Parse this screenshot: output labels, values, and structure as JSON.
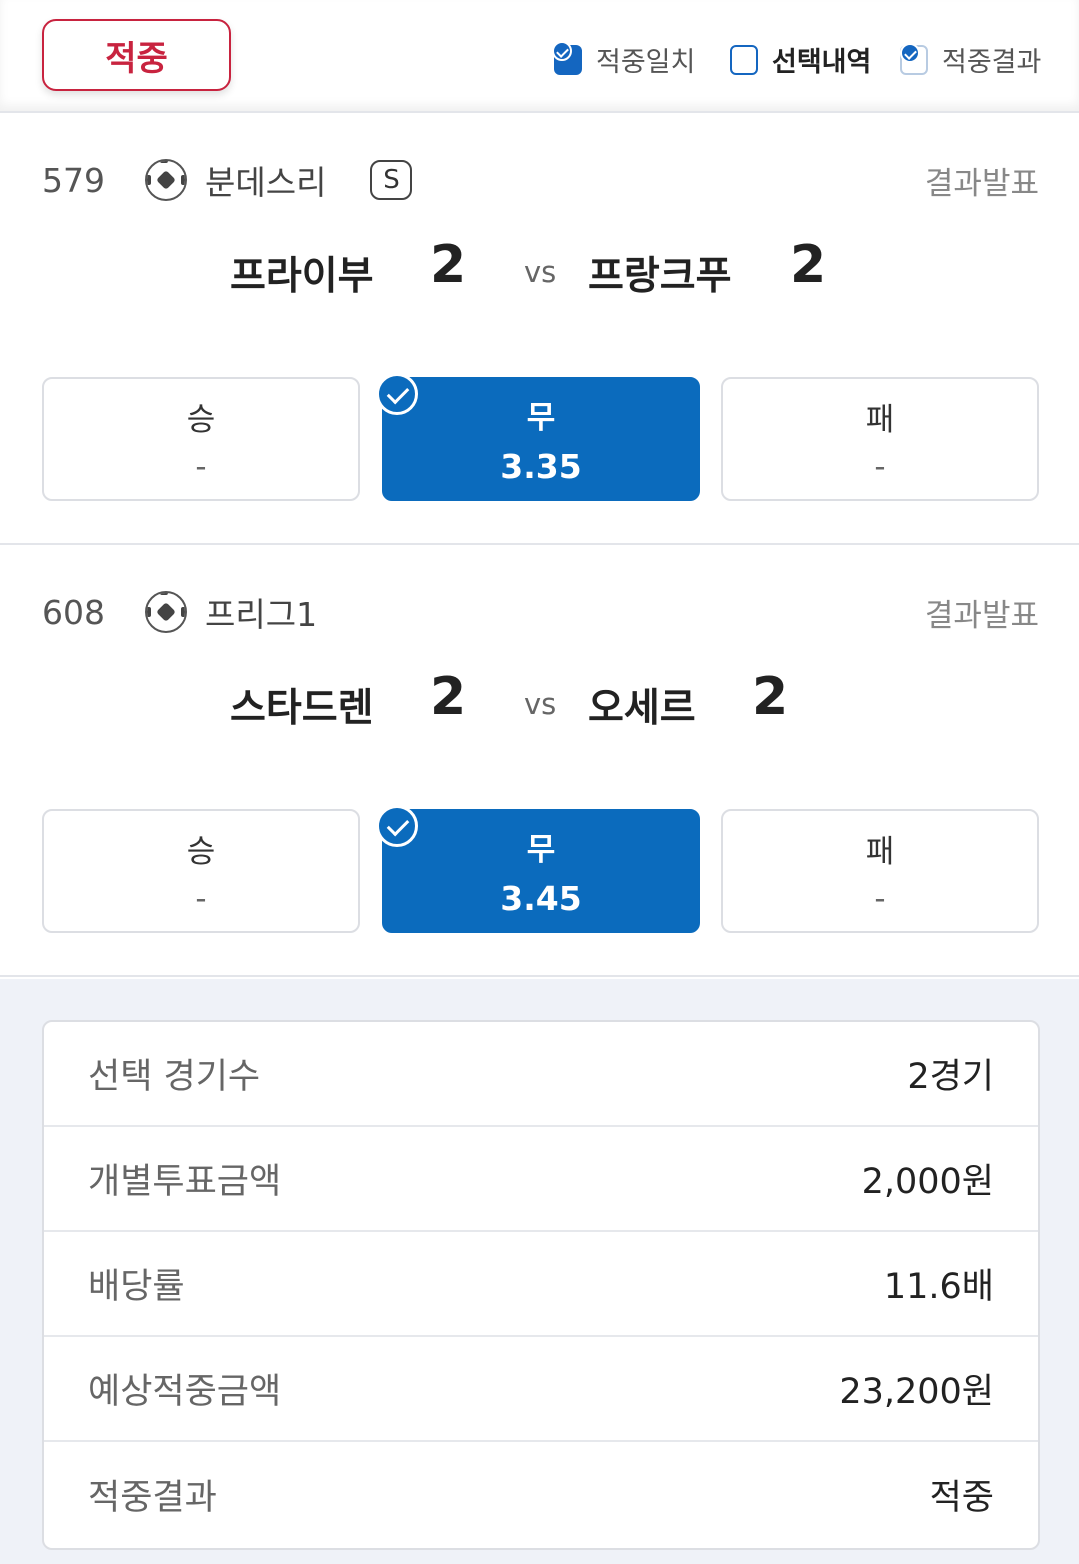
{
  "header": {
    "result_badge": "적중",
    "legend": [
      {
        "label": "적중일치"
      },
      {
        "label": "선택내역"
      },
      {
        "label": "적중결과"
      }
    ]
  },
  "games": [
    {
      "number": "579",
      "league": "분데스리",
      "special_badge": "S",
      "status": "결과발표",
      "home_team": "프라이부",
      "home_score": "2",
      "vs": "vs",
      "away_team": "프랑크푸",
      "away_score": "2",
      "options": [
        {
          "label": "승",
          "odds": "-",
          "selected": false
        },
        {
          "label": "무",
          "odds": "3.35",
          "selected": true
        },
        {
          "label": "패",
          "odds": "-",
          "selected": false
        }
      ]
    },
    {
      "number": "608",
      "league": "프리그1",
      "status": "결과발표",
      "home_team": "스타드렌",
      "home_score": "2",
      "vs": "vs",
      "away_team": "오세르",
      "away_score": "2",
      "options": [
        {
          "label": "승",
          "odds": "-",
          "selected": false
        },
        {
          "label": "무",
          "odds": "3.45",
          "selected": true
        },
        {
          "label": "패",
          "odds": "-",
          "selected": false
        }
      ]
    }
  ],
  "summary": [
    {
      "key": "선택 경기수",
      "value": "2경기"
    },
    {
      "key": "개별투표금액",
      "value": "2,000원"
    },
    {
      "key": "배당률",
      "value": "11.6배"
    },
    {
      "key": "예상적중금액",
      "value": "23,200원"
    },
    {
      "key": "적중결과",
      "value": "적중"
    }
  ],
  "colors": {
    "accent_blue": "#0b6bbd",
    "hit_red": "#c8233f"
  },
  "icons": [
    "soccer-ball-icon",
    "check-circle-icon"
  ]
}
